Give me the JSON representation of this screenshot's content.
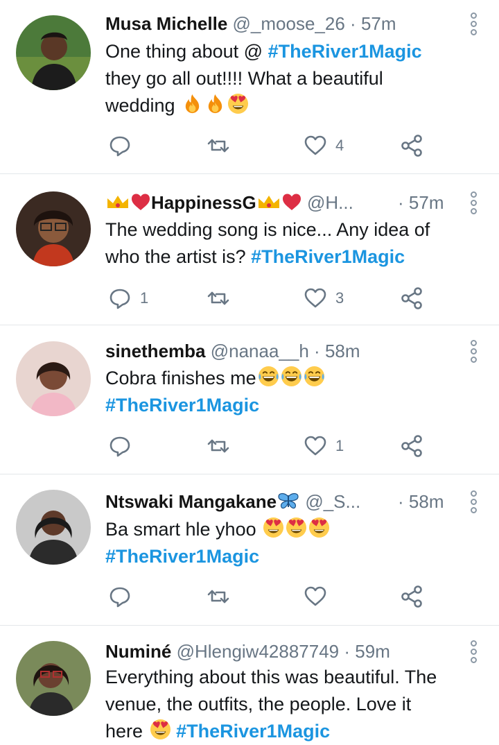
{
  "tweets": [
    {
      "name": "Musa Michelle",
      "handle": "@_moose_26",
      "separator": "·",
      "time": "57m",
      "text_lines": [
        "One thing about @ ",
        "they go all out!!!! What a beautiful",
        "wedding "
      ],
      "hashtag": "#TheRiver1Magic",
      "reply_count": "",
      "retweet_count": "",
      "like_count": "4"
    },
    {
      "name": "HappinessG",
      "handle": "@H...",
      "separator": "·",
      "time": "57m",
      "text_lines": [
        "The wedding song is nice... Any idea of",
        "who the artist is? "
      ],
      "hashtag": "#TheRiver1Magic",
      "reply_count": "1",
      "retweet_count": "",
      "like_count": "3"
    },
    {
      "name": "sinethemba",
      "handle": "@nanaa__h",
      "separator": "·",
      "time": "58m",
      "text_lines": [
        "Cobra finishes me"
      ],
      "hashtag": "#TheRiver1Magic",
      "reply_count": "",
      "retweet_count": "",
      "like_count": "1"
    },
    {
      "name": "Ntswaki Mangakane",
      "handle": "@_S...",
      "separator": "·",
      "time": "58m",
      "text_lines": [
        "Ba smart hle yhoo "
      ],
      "hashtag": "#TheRiver1Magic",
      "reply_count": "",
      "retweet_count": "",
      "like_count": ""
    },
    {
      "name": "Numiné",
      "handle": "@Hlengiw42887749",
      "separator": "·",
      "time": "59m",
      "text_lines": [
        "Everything about this was beautiful. The",
        "venue, the outfits, the people. Love it",
        "here "
      ],
      "hashtag": "#TheRiver1Magic",
      "reply_count": "",
      "retweet_count": "",
      "like_count": ""
    }
  ],
  "icons": {
    "reply": "reply-icon",
    "retweet": "retweet-icon",
    "like": "heart-icon",
    "share": "share-icon",
    "more": "more-options-icon"
  },
  "colors": {
    "hashtag": "#1b95e0",
    "meta": "#687684",
    "divider": "#e3e7ea"
  }
}
